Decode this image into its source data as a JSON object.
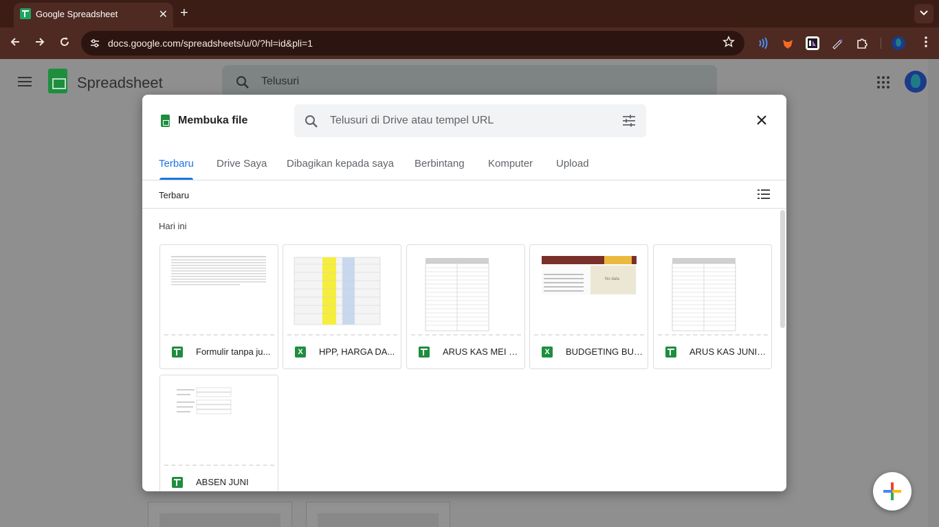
{
  "browser": {
    "tab_title": "Google Spreadsheet",
    "tab_close": "✕",
    "new_tab": "+",
    "tab_search": "⌄",
    "url": "docs.google.com/spreadsheets/u/0/?hl=id&pli=1",
    "extension_icons": [
      "wireless-extension-icon",
      "fox-extension-icon",
      "tab-extension-icon",
      "pen-extension-icon",
      "puzzle-extensions-icon"
    ]
  },
  "app": {
    "name": "Spreadsheet",
    "search_placeholder": "Telusuri"
  },
  "dialog": {
    "title": "Membuka file",
    "search_placeholder": "Telusuri di Drive atau tempel URL",
    "tabs": [
      {
        "label": "Terbaru",
        "active": true
      },
      {
        "label": "Drive Saya",
        "active": false
      },
      {
        "label": "Dibagikan kepada saya",
        "active": false
      },
      {
        "label": "Berbintang",
        "active": false
      },
      {
        "label": "Komputer",
        "active": false
      },
      {
        "label": "Upload",
        "active": false
      }
    ],
    "sort_label": "Terbaru",
    "section_label": "Hari ini",
    "files": [
      {
        "name": "Formulir tanpa ju...",
        "type": "google-sheets"
      },
      {
        "name": "HPP, HARGA DA...",
        "type": "excel"
      },
      {
        "name": "ARUS KAS MEI 2...",
        "type": "google-sheets"
      },
      {
        "name": "BUDGETING BUL...",
        "type": "excel"
      },
      {
        "name": "ARUS KAS JUNI ...",
        "type": "google-sheets"
      },
      {
        "name": "ABSEN JUNI",
        "type": "google-sheets"
      }
    ],
    "excel_badge": "X",
    "budget_preview_text": "No data"
  },
  "colors": {
    "accent": "#1a73e8",
    "sheets_green": "#1e8e3e",
    "browser_bar": "#4e2a22"
  }
}
